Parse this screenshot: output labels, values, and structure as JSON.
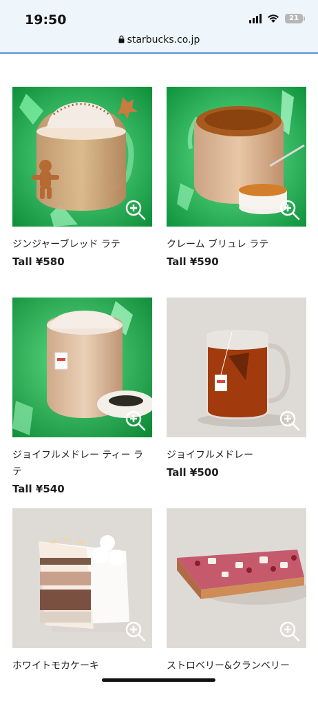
{
  "status": {
    "time": "19:50",
    "battery": "21",
    "url": "starbucks.co.jp"
  },
  "colors": {
    "green_bg": "#23b04e",
    "neutral_bg": "#dedbd7",
    "foam": "#f2e6dc",
    "latte": "#d9ad83",
    "tea": "#a13a0c"
  },
  "products": [
    {
      "name": "ジンジャーブレッド ラテ",
      "price": "Tall ¥580",
      "image": "gingerbread-latte"
    },
    {
      "name": "クレーム ブリュレ ラテ",
      "price": "Tall ¥590",
      "image": "creme-brulee-latte"
    },
    {
      "name": "ジョイフルメドレー ティー ラテ",
      "price": "Tall ¥540",
      "image": "joyful-medley-tea-latte"
    },
    {
      "name": "ジョイフルメドレー",
      "price": "Tall ¥500",
      "image": "joyful-medley-tea"
    },
    {
      "name": "ホワイトモカケーキ",
      "price": "",
      "image": "white-mocha-cake"
    },
    {
      "name": "ストロベリー&クランベリー",
      "price": "",
      "image": "strawberry-cranberry-tart"
    }
  ]
}
